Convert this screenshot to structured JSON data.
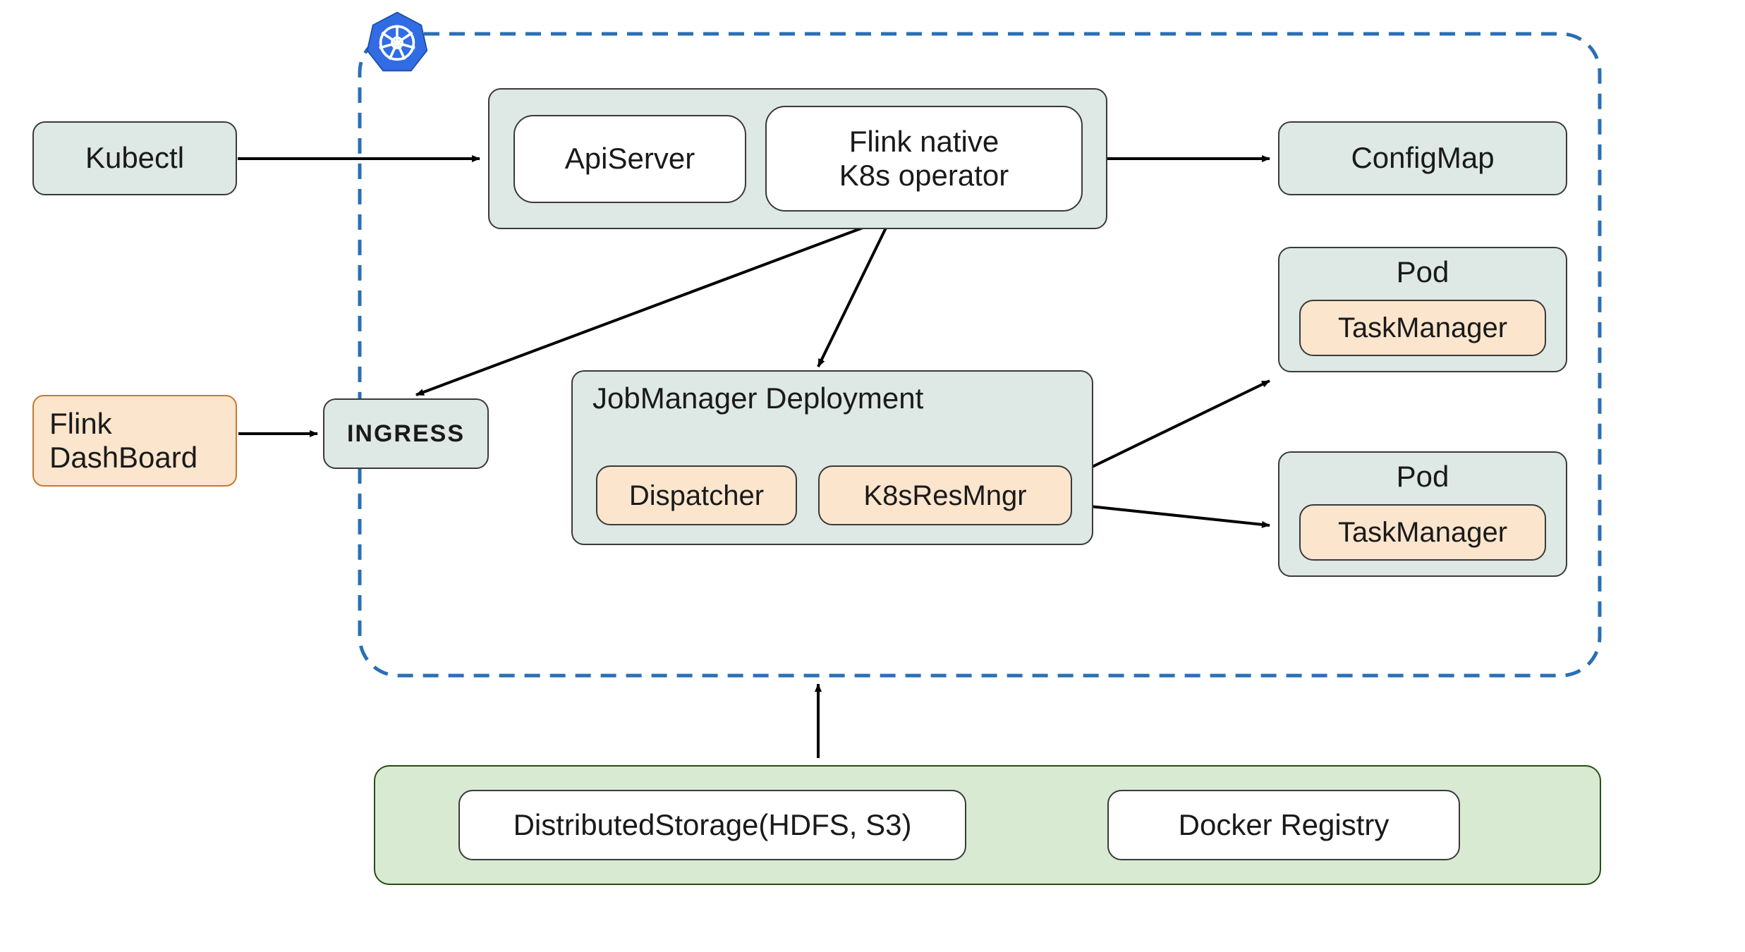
{
  "nodes": {
    "kubectl": "Kubectl",
    "flink_dashboard": "Flink\nDashBoard",
    "ingress": "INGRESS",
    "api_server": "ApiServer",
    "flink_operator": "Flink native\nK8s operator",
    "configmap": "ConfigMap",
    "jobmanager_deployment": "JobManager Deployment",
    "dispatcher": "Dispatcher",
    "k8s_resmngr": "K8sResMngr",
    "pod1": "Pod",
    "taskmanager1": "TaskManager",
    "pod2": "Pod",
    "taskmanager2": "TaskManager",
    "distributed_storage": "DistributedStorage(HDFS, S3)",
    "docker_registry": "Docker Registry"
  },
  "edges": [
    {
      "from": "kubectl",
      "to": "api_server_container"
    },
    {
      "from": "flink_dashboard",
      "to": "ingress"
    },
    {
      "from": "flink_operator",
      "to": "configmap"
    },
    {
      "from": "flink_operator",
      "to": "ingress"
    },
    {
      "from": "flink_operator",
      "to": "jobmanager_deployment"
    },
    {
      "from": "k8s_resmngr",
      "to": "pod1"
    },
    {
      "from": "k8s_resmngr",
      "to": "pod2"
    },
    {
      "from": "bottom_bar",
      "to": "cluster_boundary"
    }
  ],
  "cluster": {
    "type": "kubernetes",
    "icon": "k8s-wheel"
  }
}
